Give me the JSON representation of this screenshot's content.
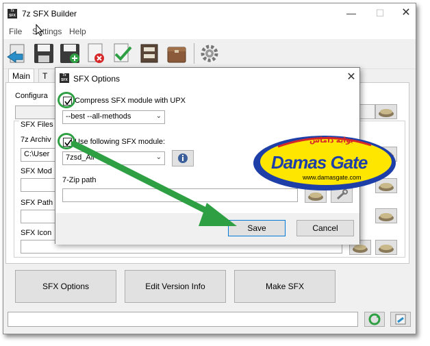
{
  "window": {
    "icon_text": "7z SFX",
    "title": "7z SFX Builder",
    "minimize": "—",
    "maximize": "☐",
    "close": "✕"
  },
  "menu": {
    "file": "File",
    "settings": "Settings",
    "help": "Help"
  },
  "toolbar": {
    "icons": [
      "open-icon",
      "save-icon",
      "save-as-icon",
      "delete-icon",
      "check-icon",
      "archive-icon",
      "package-icon",
      "settings-gear-icon"
    ]
  },
  "tabs": [
    {
      "label": "Main",
      "active": true
    },
    {
      "label": "T",
      "active": false
    }
  ],
  "main": {
    "configuration_label": "Configura",
    "sfx_files_label": "SFX Files",
    "archive_label": "7z Archiv",
    "archive_value": "C:\\User",
    "module_label": "SFX Mod",
    "path_label": "SFX Path",
    "icon_label": "SFX Icon"
  },
  "bottom_buttons": {
    "sfx_options": "SFX Options",
    "edit_version": "Edit Version Info",
    "make_sfx": "Make SFX"
  },
  "dialog": {
    "icon_text": "7z SFX",
    "title": "SFX Options",
    "close": "✕",
    "compress_label": "Compress SFX module with UPX",
    "compress_checked": true,
    "upx_option": "--best --all-methods",
    "use_module_label": "Use following SFX module:",
    "use_module_checked": true,
    "module_value": "7zsd_All",
    "info_icon": "info-icon",
    "zip_path_label": "7-Zip path",
    "save": "Save",
    "cancel": "Cancel"
  },
  "watermark": {
    "arabic": "بوابة داماس",
    "brand": "Damas Gate",
    "url": "www.damasgate.com"
  },
  "colors": {
    "accent_green": "#2ea043",
    "logo_yellow": "#ffe600",
    "logo_blue": "#1e3fa8",
    "default_button_border": "#0078d7"
  }
}
